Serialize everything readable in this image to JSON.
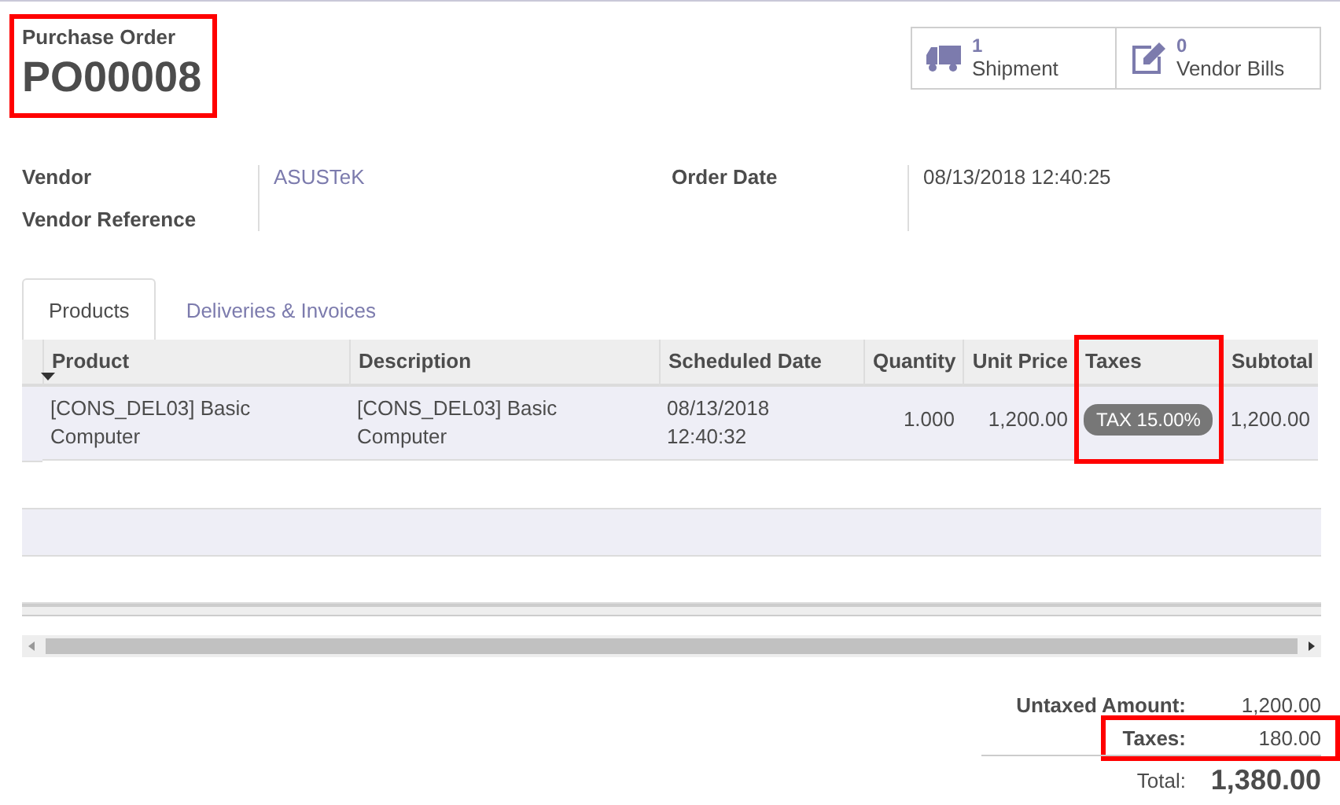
{
  "header": {
    "label": "Purchase Order",
    "number": "PO00008",
    "highlighted": true
  },
  "smart_buttons": [
    {
      "kind": "truck",
      "count": "1",
      "label": "Shipment"
    },
    {
      "kind": "edit",
      "count": "0",
      "label": "Vendor Bills"
    }
  ],
  "fields_left": [
    {
      "label": "Vendor",
      "value": "ASUSTeK"
    },
    {
      "label": "Vendor Reference"
    }
  ],
  "fields_right": [
    {
      "label": "Order Date",
      "value": "08/13/2018 12:40:25"
    }
  ],
  "tabs": [
    {
      "label": "Products",
      "selected": true
    },
    {
      "label": "Deliveries & Invoices",
      "selected": false
    }
  ],
  "table": {
    "columns": [
      {
        "label": "Product",
        "kind": "text",
        "sorted": true,
        "highlighted": false
      },
      {
        "label": "Description",
        "kind": "text",
        "sorted": false,
        "highlighted": false
      },
      {
        "label": "Scheduled Date",
        "kind": "text",
        "sorted": false,
        "highlighted": false
      },
      {
        "label": "Quantity",
        "kind": "number",
        "sorted": false,
        "highlighted": false
      },
      {
        "label": "Unit Price",
        "kind": "number",
        "sorted": false,
        "highlighted": false
      },
      {
        "label": "Taxes",
        "kind": "tag",
        "sorted": false,
        "highlighted": true
      },
      {
        "label": "Subtotal",
        "kind": "number",
        "sorted": false,
        "highlighted": false
      }
    ],
    "rows": [
      [
        "[CONS_DEL03] Basic Computer",
        "[CONS_DEL03] Basic Computer",
        "08/13/2018 12:40:32",
        "1.000",
        "1,200.00",
        "TAX 15.00%",
        "1,200.00"
      ]
    ]
  },
  "totals": [
    {
      "kind": "line",
      "label": "Untaxed Amount:",
      "value": "1,200.00",
      "highlighted": false
    },
    {
      "kind": "line",
      "label": "Taxes:",
      "value": "180.00",
      "highlighted": true
    },
    {
      "kind": "total",
      "label": "Total:",
      "value": "1,380.00",
      "highlighted": false
    }
  ]
}
